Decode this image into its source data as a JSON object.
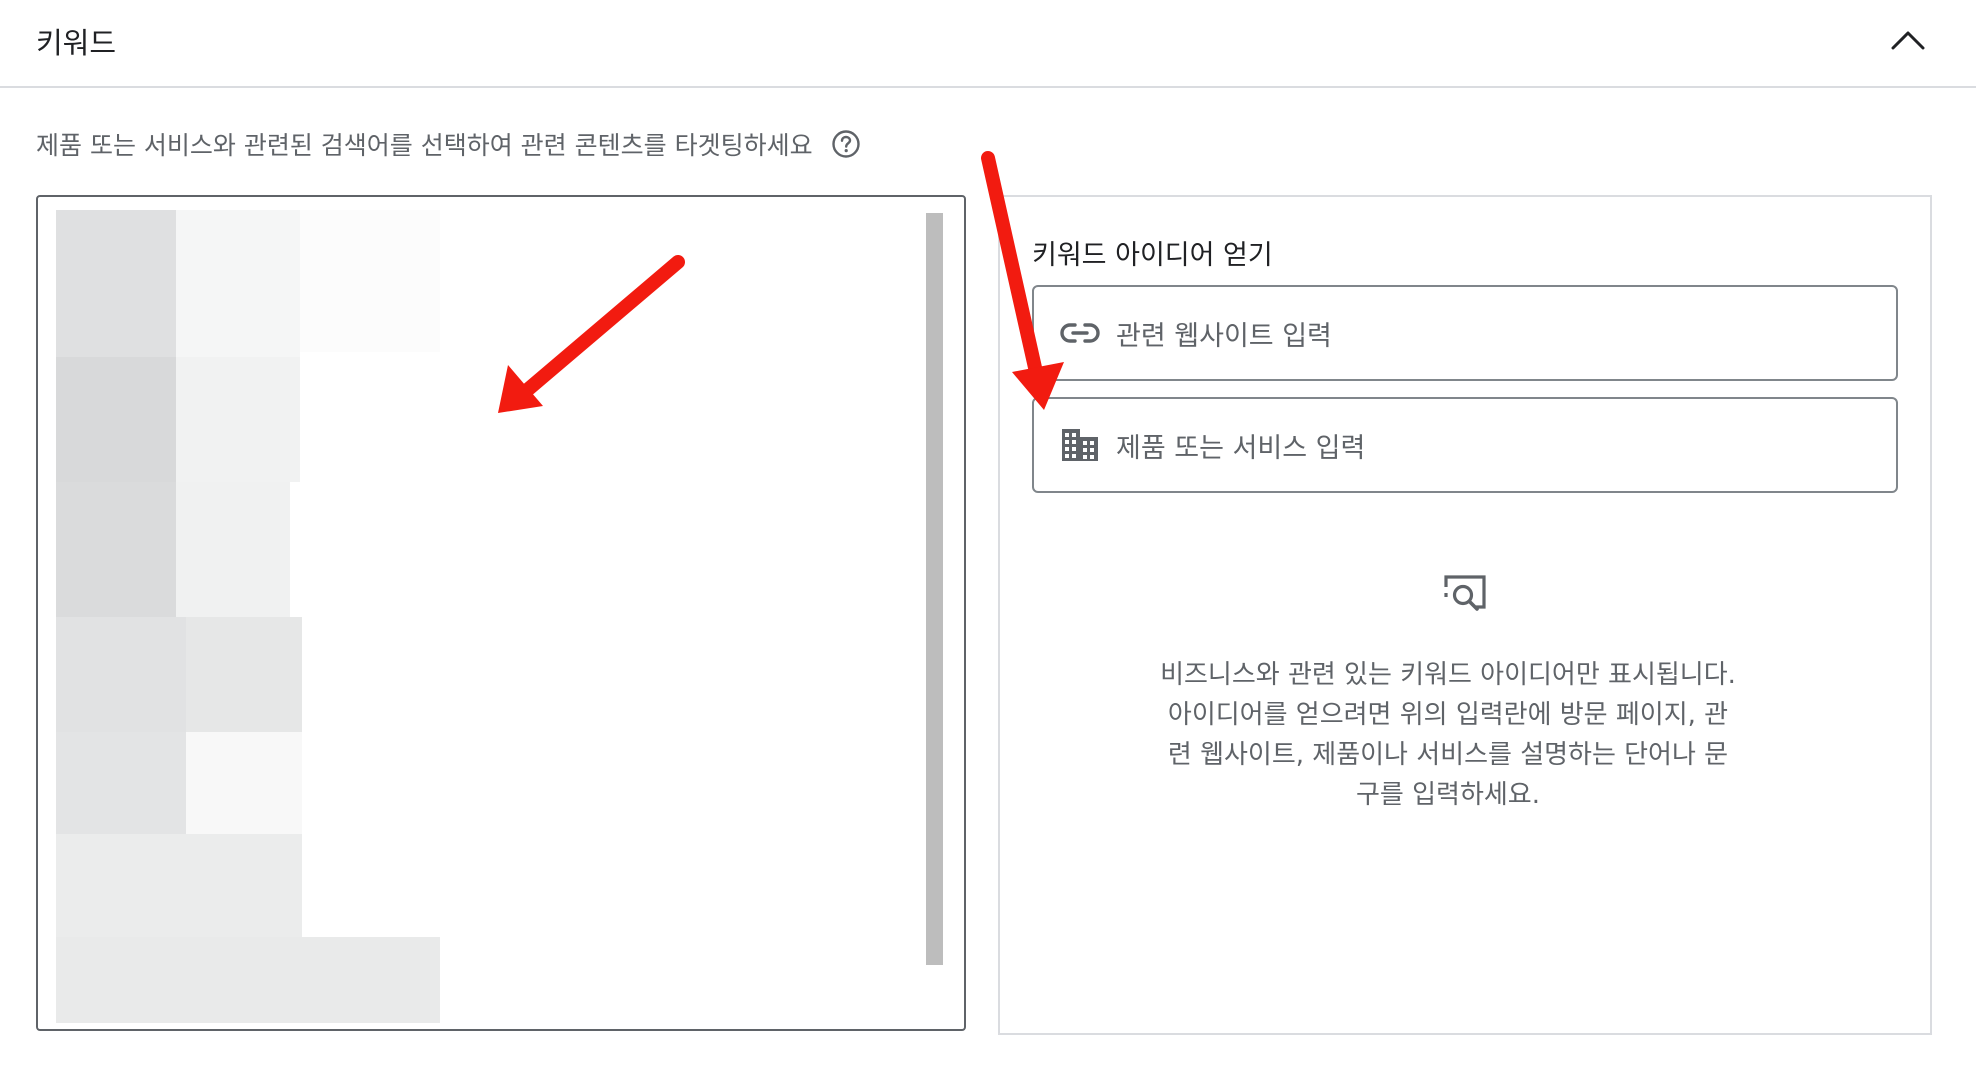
{
  "section": {
    "title": "키워드",
    "collapse_icon": "chevron-up-icon"
  },
  "description": {
    "text": "제품 또는 서비스와 관련된 검색어를 선택하여 관련 콘텐츠를 타겟팅하세요",
    "help_icon": "help-circle-icon"
  },
  "keyword_box": {
    "content_state": "blurred/redacted keyword list"
  },
  "ideas": {
    "title": "키워드 아이디어 얻기",
    "website_input": {
      "icon": "link-icon",
      "placeholder": "관련 웹사이트 입력"
    },
    "product_input": {
      "icon": "building-icon",
      "placeholder": "제품 또는 서비스 입력"
    },
    "empty_icon": "search-zoom-icon",
    "empty_message": "비즈니스와 관련 있는 키워드 아이디어만 표시됩니다. 아이디어를 얻으려면 위의 입력란에 방문 페이지, 관련 웹사이트, 제품이나 서비스를 설명하는 단어나 문구를 입력하세요."
  },
  "annotations": {
    "arrow_color": "#f21b10"
  },
  "colors": {
    "border": "#5f6368",
    "divider": "#dadce0",
    "muted_text": "#5f6368",
    "annotation_red": "#f21b10"
  }
}
